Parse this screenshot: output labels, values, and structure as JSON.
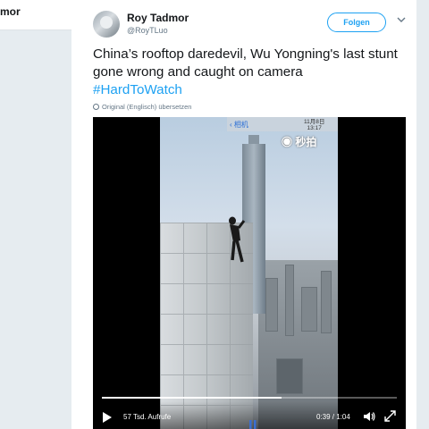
{
  "background": {
    "left_label": "mor"
  },
  "tweet": {
    "author_name": "Roy Tadmor",
    "author_handle": "@RoyTLuo",
    "follow_label": "Folgen",
    "text": "China’s rooftop daredevil, Wu Yongning's last stunt gone wrong and caught on camera",
    "hashtag": "#HardToWatch",
    "translate_note": "Original (Englisch) übersetzen"
  },
  "video": {
    "camera_back_label": "‹ 相机",
    "camera_date": "11月8日",
    "camera_time": "13:17",
    "watermark": "秒拍",
    "views": "57 Tsd. Aufrufe",
    "time": "0:39 / 1:04",
    "progress_fraction": 0.61
  },
  "colors": {
    "accent": "#1da1f2",
    "text": "#14171a",
    "muted": "#657786"
  },
  "icons": [
    "avatar",
    "chevron-down-icon",
    "globe-icon",
    "play-icon",
    "volume-icon",
    "fullscreen-icon",
    "camera-icon"
  ]
}
